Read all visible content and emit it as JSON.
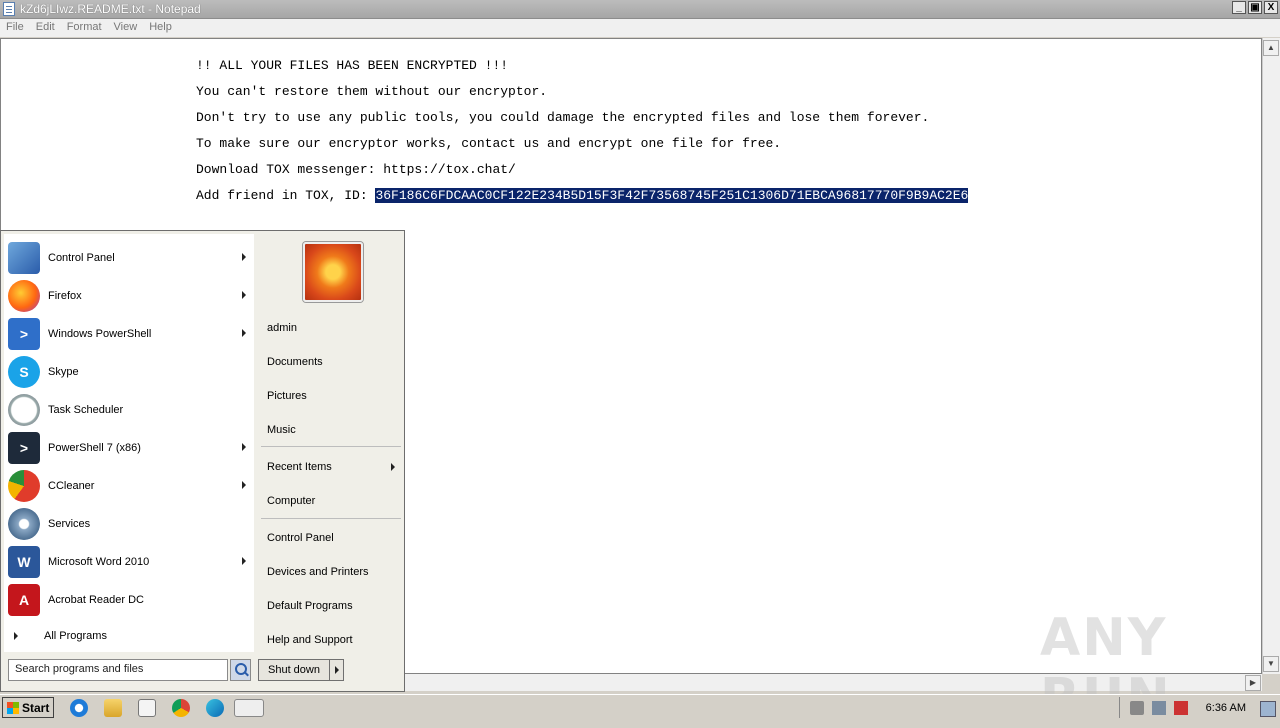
{
  "window": {
    "title": "kZd6jLIwz.README.txt - Notepad",
    "buttons": [
      "_",
      "▣",
      "X"
    ]
  },
  "menu": [
    "File",
    "Edit",
    "Format",
    "View",
    "Help"
  ],
  "document": {
    "lines": [
      "!! ALL YOUR FILES HAS BEEN ENCRYPTED !!!",
      "You can't restore them without our encryptor.",
      "Don't try to use any public tools, you could damage the encrypted files and lose them forever.",
      "To make sure our encryptor works, contact us and encrypt one file for free.",
      "Download TOX messenger: https://tox.chat/"
    ],
    "id_prefix": "Add friend in TOX, ID: ",
    "id_selected": "36F186C6FDCAAC0CF122E234B5D15F3F42F73568745F251C1306D71EBCA96817770F9B9AC2E6"
  },
  "startmenu": {
    "programs": [
      {
        "label": "Control Panel",
        "icon": "control-panel-icon",
        "arrow": true
      },
      {
        "label": "Firefox",
        "icon": "firefox-icon",
        "arrow": true
      },
      {
        "label": "Windows PowerShell",
        "icon": "powershell-icon",
        "arrow": true
      },
      {
        "label": "Skype",
        "icon": "skype-icon",
        "arrow": false
      },
      {
        "label": "Task Scheduler",
        "icon": "clock-icon",
        "arrow": false
      },
      {
        "label": "PowerShell 7 (x86)",
        "icon": "powershell7-icon",
        "arrow": true
      },
      {
        "label": "CCleaner",
        "icon": "ccleaner-icon",
        "arrow": true
      },
      {
        "label": "Services",
        "icon": "gears-icon",
        "arrow": false
      },
      {
        "label": "Microsoft Word 2010",
        "icon": "word-icon",
        "arrow": true
      },
      {
        "label": "Acrobat Reader DC",
        "icon": "acrobat-icon",
        "arrow": false
      }
    ],
    "all_programs": "All Programs",
    "search_placeholder": "Search programs and files",
    "right_items": {
      "admin": "admin",
      "documents": "Documents",
      "pictures": "Pictures",
      "music": "Music",
      "recent": "Recent Items",
      "computer": "Computer",
      "control_panel": "Control Panel",
      "devices": "Devices and Printers",
      "defaults": "Default Programs",
      "help": "Help and Support"
    },
    "shutdown": "Shut down"
  },
  "taskbar": {
    "start_label": "Start",
    "clock": "6:36 AM"
  },
  "watermark": "ANY RUN"
}
